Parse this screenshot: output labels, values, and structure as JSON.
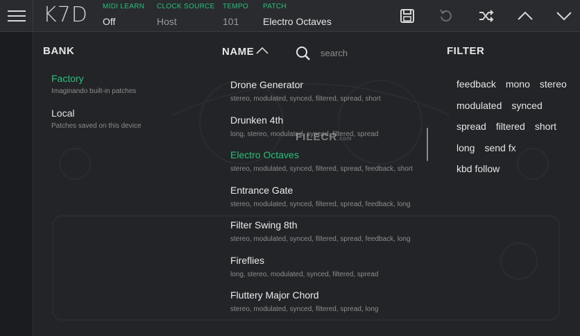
{
  "header": {
    "logo": "K7D",
    "midi_learn": {
      "label": "MIDI LEARN",
      "value": "Off"
    },
    "clock_source": {
      "label": "CLOCK SOURCE",
      "value": "Host"
    },
    "tempo": {
      "label": "TEMPO",
      "value": "101"
    },
    "patch": {
      "label": "PATCH",
      "value": "Electro Octaves"
    }
  },
  "bank": {
    "title": "BANK",
    "items": [
      {
        "name": "Factory",
        "desc": "Imaginando built-in patches"
      },
      {
        "name": "Local",
        "desc": "Patches saved on this device"
      }
    ]
  },
  "name_column": {
    "title": "NAME",
    "search_placeholder": "search"
  },
  "patches": [
    {
      "name": "Drone Generator",
      "tags": "stereo, modulated, synced, filtered, spread, short"
    },
    {
      "name": "Drunken 4th",
      "tags": "long, stereo, modulated, synced, filtered, spread"
    },
    {
      "name": "Electro Octaves",
      "tags": "stereo, modulated, synced, filtered, spread, feedback, short"
    },
    {
      "name": "Entrance Gate",
      "tags": "stereo, modulated, synced, filtered, spread, feedback, long"
    },
    {
      "name": "Filter Swing 8th",
      "tags": "stereo, modulated, synced, filtered, spread, feedback, long"
    },
    {
      "name": "Fireflies",
      "tags": "long, stereo, modulated, synced, filtered, spread"
    },
    {
      "name": "Fluttery Major Chord",
      "tags": "stereo, modulated, synced, filtered, spread, long"
    }
  ],
  "filter": {
    "title": "FILTER",
    "rows": [
      [
        "feedback",
        "mono",
        "stereo"
      ],
      [
        "modulated",
        "synced"
      ],
      [
        "spread",
        "filtered",
        "short"
      ],
      [
        "long",
        "send fx"
      ],
      [
        "kbd follow"
      ]
    ]
  },
  "watermark": {
    "text": "FILECR",
    "suffix": ".com"
  },
  "colors": {
    "accent": "#29c07a",
    "background": "#232427",
    "topbar": "#2a2b2f"
  }
}
